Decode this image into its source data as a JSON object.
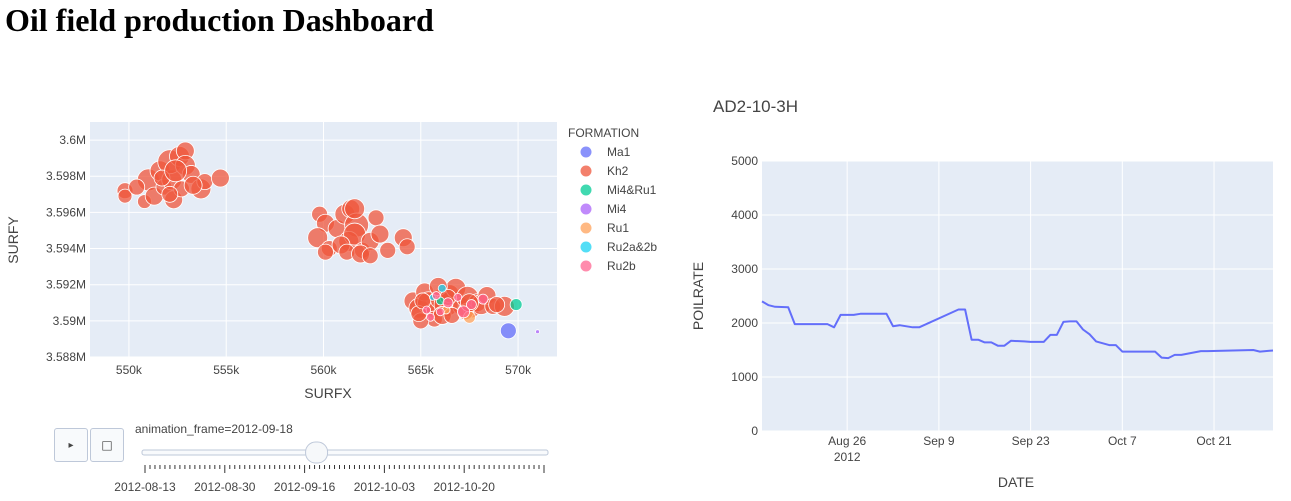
{
  "page": {
    "title": "Oil field production Dashboard"
  },
  "map_chart": {
    "xlabel": "SURFX",
    "ylabel": "SURFY",
    "legend_title": "FORMATION",
    "animation_label": "animation_frame=2012-09-18",
    "slider_ticks": [
      "2012-08-13",
      "2012-08-30",
      "2012-09-16",
      "2012-10-03",
      "2012-10-20"
    ],
    "slider_value": 0.43
  },
  "line_chart": {
    "title": "AD2-10-3H",
    "xlabel": "DATE",
    "ylabel": "POILRATE"
  },
  "chart_data": [
    {
      "type": "scatter",
      "title": "",
      "xlabel": "SURFX",
      "ylabel": "SURFY",
      "xlim": [
        548000,
        572000
      ],
      "ylim": [
        3588000,
        3601000
      ],
      "x_ticks": [
        550000,
        555000,
        560000,
        565000,
        570000
      ],
      "x_tick_labels": [
        "550k",
        "555k",
        "560k",
        "565k",
        "570k"
      ],
      "y_ticks": [
        3588000,
        3590000,
        3592000,
        3594000,
        3596000,
        3598000,
        3600000
      ],
      "y_tick_labels": [
        "3.588M",
        "3.59M",
        "3.592M",
        "3.594M",
        "3.596M",
        "3.598M",
        "3.6M"
      ],
      "grid": true,
      "legend_position": "right",
      "series": [
        {
          "name": "Ma1",
          "color": "#636efa",
          "points": [
            [
              569500,
              3589450,
              8
            ]
          ]
        },
        {
          "name": "Kh2",
          "color": "#ef553b",
          "points": [
            [
              549800,
              3597200,
              8
            ],
            [
              549800,
              3596900,
              7
            ],
            [
              550800,
              3596600,
              7
            ],
            [
              551000,
              3597800,
              11
            ],
            [
              551600,
              3598300,
              10
            ],
            [
              551300,
              3596900,
              9
            ],
            [
              551800,
              3597400,
              8
            ],
            [
              552200,
              3597800,
              10
            ],
            [
              552100,
              3598800,
              12
            ],
            [
              552600,
              3599100,
              10
            ],
            [
              552900,
              3599400,
              9
            ],
            [
              552300,
              3596700,
              9
            ],
            [
              552700,
              3597300,
              8
            ],
            [
              552900,
              3598600,
              10
            ],
            [
              553200,
              3598100,
              9
            ],
            [
              553700,
              3597300,
              10
            ],
            [
              553900,
              3597700,
              8
            ],
            [
              554700,
              3597900,
              9
            ],
            [
              551700,
              3597900,
              8
            ],
            [
              552400,
              3598300,
              11
            ],
            [
              552100,
              3597000,
              8
            ],
            [
              553300,
              3597500,
              9
            ],
            [
              550400,
              3597400,
              8
            ],
            [
              559800,
              3595900,
              8
            ],
            [
              560100,
              3595400,
              9
            ],
            [
              559700,
              3594600,
              10
            ],
            [
              560300,
              3594000,
              8
            ],
            [
              560700,
              3595100,
              9
            ],
            [
              561100,
              3595900,
              10
            ],
            [
              561400,
              3596200,
              9
            ],
            [
              561700,
              3595300,
              12
            ],
            [
              561300,
              3594400,
              10
            ],
            [
              561600,
              3594800,
              11
            ],
            [
              560900,
              3594200,
              9
            ],
            [
              561200,
              3593800,
              8
            ],
            [
              562000,
              3593900,
              8
            ],
            [
              562400,
              3594400,
              9
            ],
            [
              562700,
              3595700,
              8
            ],
            [
              561600,
              3596200,
              10
            ],
            [
              561900,
              3593700,
              9
            ],
            [
              562400,
              3593600,
              8
            ],
            [
              562900,
              3594800,
              9
            ],
            [
              563300,
              3593900,
              8
            ],
            [
              564100,
              3594600,
              9
            ],
            [
              564300,
              3594100,
              8
            ],
            [
              560100,
              3593800,
              8
            ],
            [
              564600,
              3591100,
              9
            ],
            [
              564900,
              3590700,
              10
            ],
            [
              565200,
              3591600,
              9
            ],
            [
              565400,
              3591000,
              11
            ],
            [
              565700,
              3590600,
              8
            ],
            [
              566000,
              3591200,
              10
            ],
            [
              566300,
              3590900,
              12
            ],
            [
              566500,
              3591500,
              9
            ],
            [
              566800,
              3591800,
              10
            ],
            [
              567100,
              3590800,
              9
            ],
            [
              567400,
              3591300,
              11
            ],
            [
              567600,
              3590600,
              8
            ],
            [
              567900,
              3591000,
              9
            ],
            [
              568100,
              3590900,
              10
            ],
            [
              568400,
              3591400,
              9
            ],
            [
              568700,
              3590800,
              8
            ],
            [
              569300,
              3590800,
              10
            ],
            [
              565700,
              3590100,
              8
            ],
            [
              566100,
              3590300,
              9
            ],
            [
              566600,
              3590300,
              8
            ],
            [
              567300,
              3590500,
              8
            ],
            [
              565000,
              3590000,
              8
            ],
            [
              564900,
              3590400,
              8
            ],
            [
              565900,
              3591900,
              9
            ],
            [
              566400,
              3591300,
              8
            ],
            [
              567500,
              3591000,
              9
            ],
            [
              568900,
              3590900,
              8
            ],
            [
              565100,
              3591100,
              8
            ]
          ]
        },
        {
          "name": "Mi4&Ru1",
          "color": "#00cc96",
          "points": [
            [
              569900,
              3590900,
              6
            ],
            [
              566000,
              3591100,
              4
            ]
          ]
        },
        {
          "name": "Mi4",
          "color": "#ab63fa",
          "points": [
            [
              571000,
              3589400,
              2
            ]
          ]
        },
        {
          "name": "Ru1",
          "color": "#ffa15a",
          "points": [
            [
              567500,
              3590200,
              6
            ],
            [
              566300,
              3590600,
              4
            ]
          ]
        },
        {
          "name": "Ru2a&2b",
          "color": "#19d3f3",
          "points": [
            [
              566100,
              3591800,
              4
            ],
            [
              565600,
              3591300,
              3
            ]
          ]
        },
        {
          "name": "Ru2b",
          "color": "#ff6692",
          "points": [
            [
              567200,
              3590500,
              6
            ],
            [
              566400,
              3591000,
              5
            ],
            [
              567600,
              3590900,
              5
            ],
            [
              565300,
              3590600,
              4
            ],
            [
              565800,
              3591400,
              4
            ],
            [
              566900,
              3591300,
              4
            ],
            [
              566000,
              3590500,
              4
            ],
            [
              568200,
              3591200,
              5
            ],
            [
              565500,
              3590200,
              4
            ]
          ]
        }
      ]
    },
    {
      "type": "line",
      "title": "AD2-10-3H",
      "xlabel": "DATE",
      "ylabel": "POILRATE",
      "xlim": [
        "2012-08-13",
        "2012-10-30"
      ],
      "ylim": [
        0,
        5000
      ],
      "y_ticks": [
        0,
        1000,
        2000,
        3000,
        4000,
        5000
      ],
      "x_tick_labels": [
        {
          "date": "2012-08-26",
          "label": "Aug 26",
          "sub": "2012"
        },
        {
          "date": "2012-09-09",
          "label": "Sep 9"
        },
        {
          "date": "2012-09-23",
          "label": "Sep 23"
        },
        {
          "date": "2012-10-07",
          "label": "Oct 7"
        },
        {
          "date": "2012-10-21",
          "label": "Oct 21"
        }
      ],
      "grid": true,
      "color": "#636efa",
      "series": [
        {
          "x": [
            "2012-08-13",
            "2012-08-14",
            "2012-08-15",
            "2012-08-17",
            "2012-08-18",
            "2012-08-23",
            "2012-08-24",
            "2012-08-25",
            "2012-08-27",
            "2012-08-28",
            "2012-09-01",
            "2012-09-02",
            "2012-09-03",
            "2012-09-05",
            "2012-09-06",
            "2012-09-12",
            "2012-09-13",
            "2012-09-14",
            "2012-09-15",
            "2012-09-16",
            "2012-09-17",
            "2012-09-18",
            "2012-09-19",
            "2012-09-20",
            "2012-09-22",
            "2012-09-23",
            "2012-09-25",
            "2012-09-26",
            "2012-09-27",
            "2012-09-28",
            "2012-09-29",
            "2012-09-30",
            "2012-10-01",
            "2012-10-02",
            "2012-10-03",
            "2012-10-05",
            "2012-10-06",
            "2012-10-07",
            "2012-10-12",
            "2012-10-13",
            "2012-10-14",
            "2012-10-15",
            "2012-10-16",
            "2012-10-19",
            "2012-10-20",
            "2012-10-27",
            "2012-10-28",
            "2012-10-30"
          ],
          "y": [
            2400,
            2330,
            2300,
            2290,
            1980,
            1980,
            1920,
            2150,
            2150,
            2170,
            2170,
            1940,
            1960,
            1920,
            1920,
            2250,
            2250,
            1690,
            1690,
            1640,
            1640,
            1580,
            1580,
            1670,
            1660,
            1650,
            1650,
            1780,
            1780,
            2020,
            2030,
            2030,
            1880,
            1790,
            1660,
            1590,
            1590,
            1470,
            1470,
            1360,
            1350,
            1410,
            1410,
            1480,
            1480,
            1500,
            1470,
            1490
          ]
        }
      ]
    }
  ]
}
